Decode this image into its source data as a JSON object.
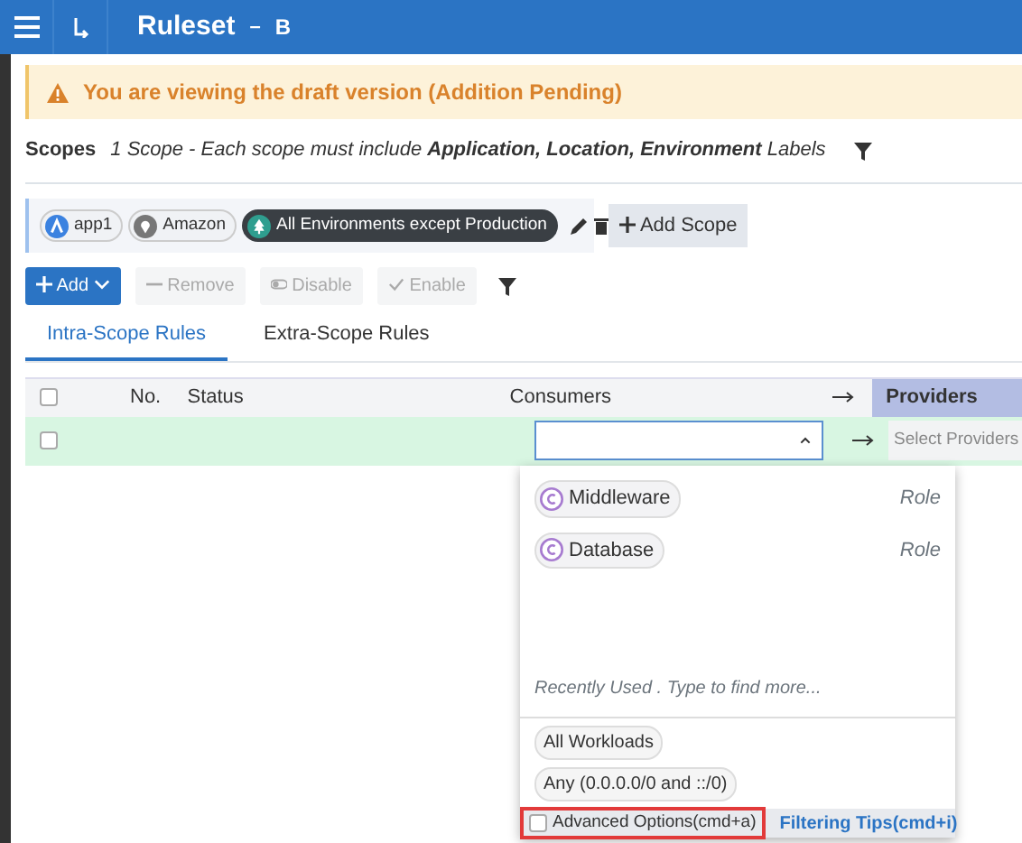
{
  "header": {
    "title": "Ruleset",
    "separator": "–",
    "name": "B"
  },
  "alert": {
    "text": "You are viewing the draft version (Addition Pending)"
  },
  "scopes": {
    "label": "Scopes",
    "info": "1 Scope - Each scope must include **Application, Location, Environment** Labels",
    "labels": [
      {
        "text": "app1",
        "kind": "app"
      },
      {
        "text": "Amazon",
        "kind": "location"
      },
      {
        "text": "All Environments except Production",
        "kind": "environment"
      }
    ],
    "add_button": "Add Scope"
  },
  "toolbar": [
    {
      "label": "Add",
      "kind": "add",
      "disabled": false
    },
    {
      "label": "Remove",
      "kind": "remove",
      "disabled": true
    },
    {
      "label": "Disable",
      "kind": "disable",
      "disabled": true
    },
    {
      "label": "Enable",
      "kind": "enable",
      "disabled": true
    }
  ],
  "tabs": [
    {
      "label": "Intra-Scope Rules",
      "selected": true
    },
    {
      "label": "Extra-Scope Rules",
      "selected": false
    }
  ],
  "table": {
    "select_all": false,
    "columns": [
      "No.",
      "Status",
      "Consumers",
      "Providers"
    ],
    "rows": [
      {
        "checked": false,
        "consumer_value": "",
        "providers_placeholder": "Select Providers"
      }
    ]
  },
  "dropdown": {
    "items": [
      {
        "label": "Middleware",
        "type": "Role"
      },
      {
        "label": "Database",
        "type": "Role"
      }
    ],
    "hint": "Recently Used . Type to find more...",
    "options": [
      "All Workloads",
      "Any (0.0.0.0/0 and ::/0)"
    ],
    "advanced": {
      "label": "Advanced Options(cmd+a)",
      "checked": false
    },
    "tips": "Filtering Tips(cmd+i)"
  }
}
